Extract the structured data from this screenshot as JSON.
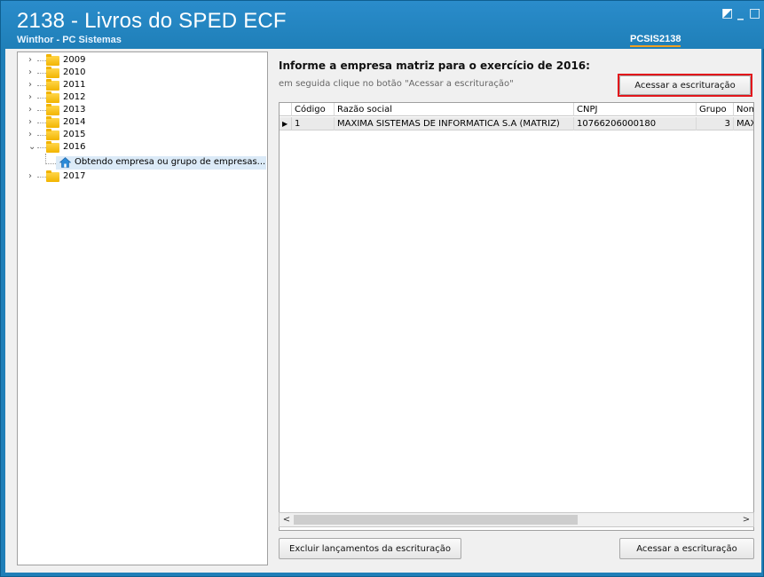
{
  "window": {
    "title": "2138 - Livros do SPED ECF",
    "subtitle": "Winthor - PC Sistemas",
    "routine_code": "PCSIS2138",
    "controls": {
      "restore": "◩",
      "minimize": "_",
      "maximize": "□"
    }
  },
  "tree": {
    "items": [
      {
        "label": "2009",
        "expander": "›"
      },
      {
        "label": "2010",
        "expander": "›"
      },
      {
        "label": "2011",
        "expander": "›"
      },
      {
        "label": "2012",
        "expander": "›"
      },
      {
        "label": "2013",
        "expander": "›"
      },
      {
        "label": "2014",
        "expander": "›"
      },
      {
        "label": "2015",
        "expander": "›"
      },
      {
        "label": "2016",
        "expander": "⌄"
      },
      {
        "label": "2017",
        "expander": "›"
      }
    ],
    "child_of_2016": "Obtendo empresa ou grupo de empresas..."
  },
  "main": {
    "heading": "Informe a empresa matriz para o exercício de 2016:",
    "hint": "em seguida clique no botão \"Acessar a escrituração\"",
    "access_button_top": "Acessar a escrituração",
    "grid": {
      "columns": [
        "Código",
        "Razão social",
        "CNPJ",
        "Grupo",
        "Nome"
      ],
      "rows": [
        {
          "indicator": "▶",
          "codigo": "1",
          "razao_social": "MAXIMA SISTEMAS DE INFORMATICA S.A (MATRIZ)",
          "cnpj": "10766206000180",
          "grupo": "3",
          "nome": "MAXI"
        }
      ]
    },
    "scroll_left": "<",
    "scroll_right": ">",
    "delete_button": "Excluir lançamentos da escrituração",
    "access_button_bottom": "Acessar a escrituração"
  },
  "colors": {
    "titlebar": "#1f7fb8",
    "highlight": "#e2161b",
    "selection": "#dbeaf7",
    "folder": "#f2b400"
  }
}
